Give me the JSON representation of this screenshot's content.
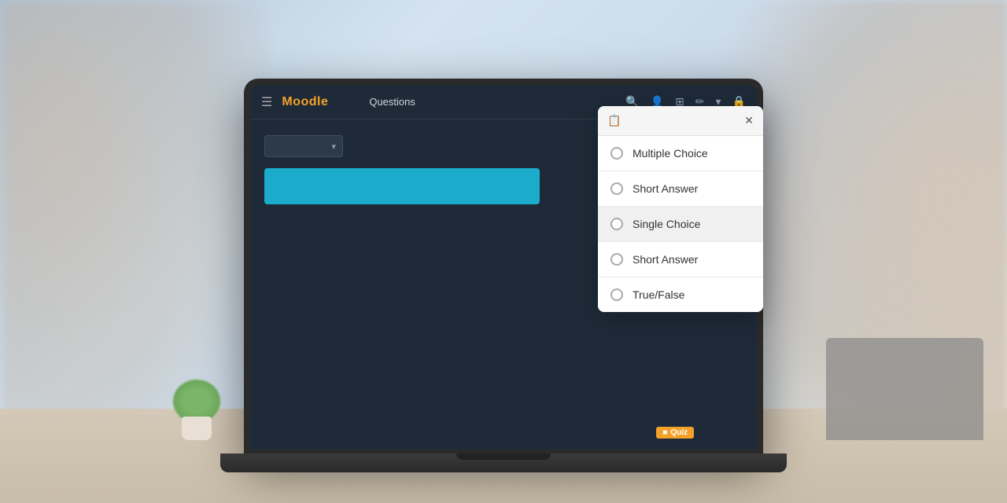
{
  "background": {
    "description": "Office background with people"
  },
  "navbar": {
    "logo": "Moodle",
    "title": "Questions",
    "icons": [
      "search",
      "person",
      "grid",
      "edit",
      "chevron-down",
      "lock"
    ]
  },
  "content": {
    "dropdown_placeholder": "",
    "blue_bar_text": ""
  },
  "quiz_badge": {
    "label": "Quiz"
  },
  "popup": {
    "header_icon": "📋",
    "close_label": "✕",
    "items": [
      {
        "id": "multiple-choice",
        "label": "Multiple Choice",
        "selected": false
      },
      {
        "id": "short-answer-1",
        "label": "Short Answer",
        "selected": false
      },
      {
        "id": "single-choice",
        "label": "Single Choice",
        "selected": true
      },
      {
        "id": "short-answer-2",
        "label": "Short Answer",
        "selected": false
      },
      {
        "id": "true-false",
        "label": "True/False",
        "selected": false
      }
    ]
  }
}
